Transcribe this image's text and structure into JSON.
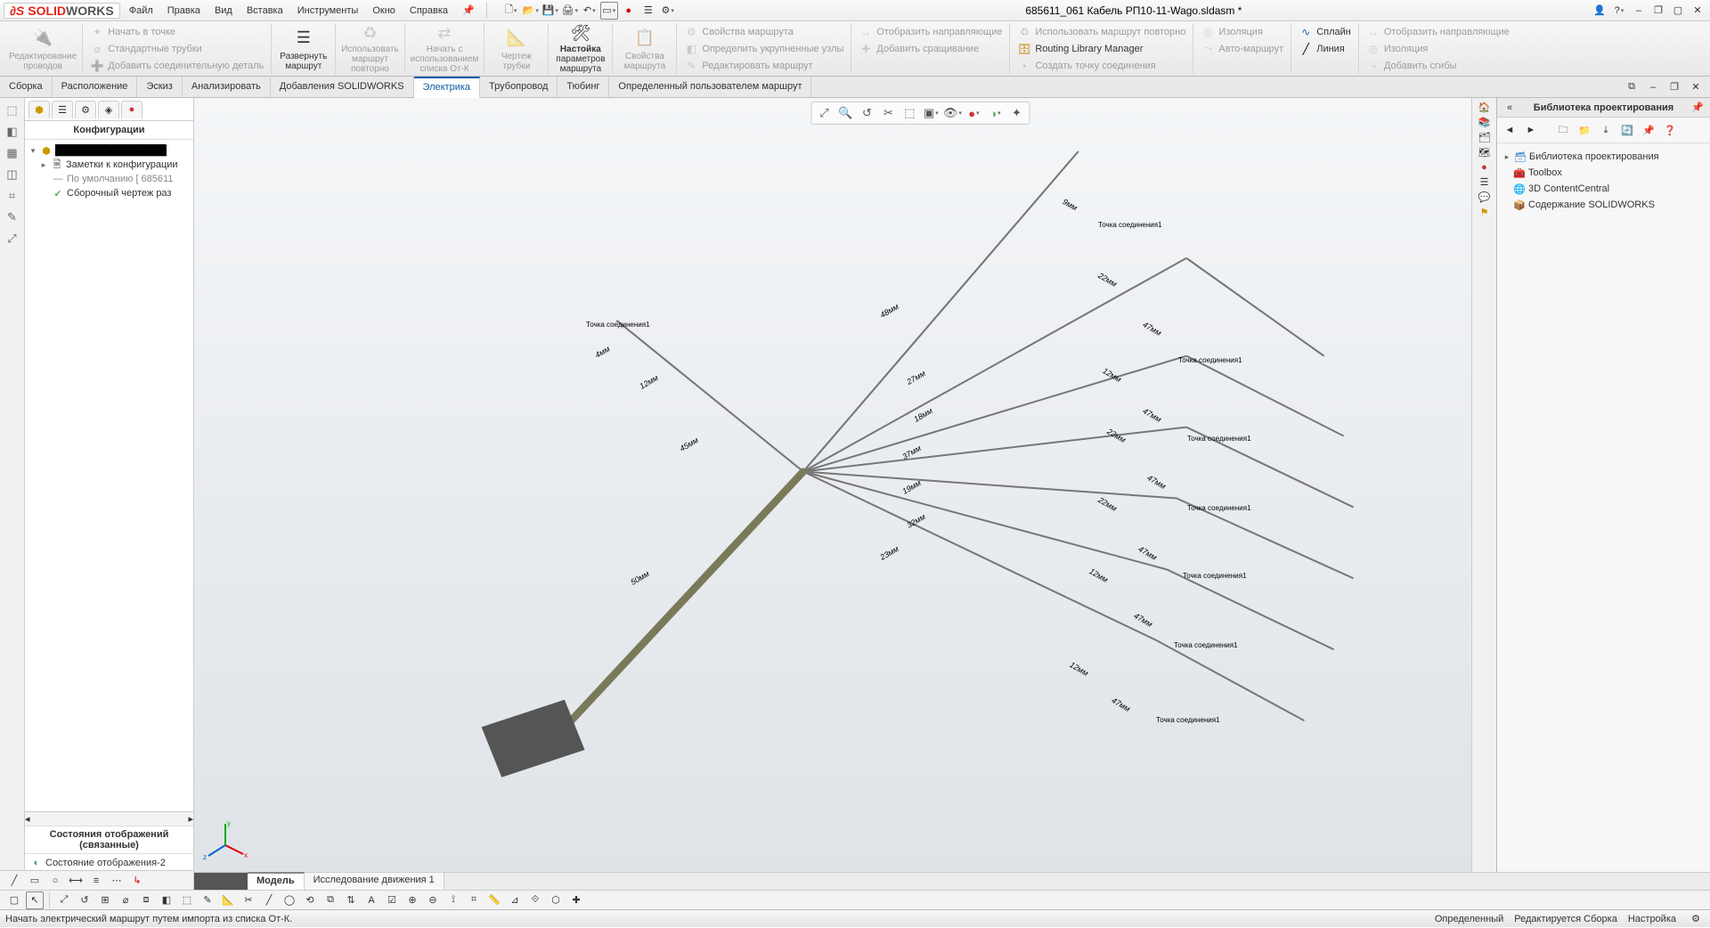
{
  "app": {
    "brand1": "SOLID",
    "brand2": "WORKS",
    "title": "685611_061 Кабель РП10-11-Wago.sldasm *"
  },
  "menu": {
    "file": "Файл",
    "edit": "Правка",
    "view": "Вид",
    "insert": "Вставка",
    "tools": "Инструменты",
    "window": "Окно",
    "help": "Справка"
  },
  "ribbon": {
    "g0": {
      "l1": "Редактирование",
      "l2": "проводов"
    },
    "g0rows": {
      "r1": "Начать в точке",
      "r2": "Стандартные трубки",
      "r3": "Добавить соединительную деталь"
    },
    "g1": {
      "l1": "Развернуть",
      "l2": "маршрут"
    },
    "g2": {
      "l1": "Использовать",
      "l2": "маршрут",
      "l3": "повторно"
    },
    "g3": {
      "l1": "Начать с",
      "l2": "использованием",
      "l3": "списка От-К"
    },
    "g4": {
      "l1": "Чертеж",
      "l2": "трубки"
    },
    "g5": {
      "l1": "Настойка",
      "l2": "параметров",
      "l3": "маршрута"
    },
    "g6": {
      "l1": "Свойства",
      "l2": "маршрута"
    },
    "col1": {
      "r1": "Свойства маршрута",
      "r2": "Определить укрупненные узлы",
      "r3": "Редактировать маршрут"
    },
    "col2": {
      "r1": "Отобразить направляющие",
      "r2": "Добавить сращивание"
    },
    "col3": {
      "r1": "Использовать маршрут повторно",
      "r2": "Routing Library Manager",
      "r3": "Создать точку соединения"
    },
    "col4": {
      "r1": "Изоляция",
      "r2": "Авто-маршрут"
    },
    "col5": {
      "r1": "Сплайн",
      "r2": "Линия"
    },
    "col6": {
      "r1": "Отобразить направляющие",
      "r2": "Изоляция",
      "r3": "Добавить сгибы"
    }
  },
  "tabs": {
    "t1": "Сборка",
    "t2": "Расположение",
    "t3": "Эскиз",
    "t4": "Анализировать",
    "t5": "Добавления SOLIDWORKS",
    "t6": "Электрика",
    "t7": "Трубопровод",
    "t8": "Тюбинг",
    "t9": "Определенный пользователем маршрут"
  },
  "fm": {
    "title": "Конфигурации",
    "root": "████████████████",
    "n1": "Заметки к конфигурации",
    "n2": "По умолчанию [ 685611",
    "n3": "Сборочный чертеж раз",
    "dispHdr": "Состояния отображений (связанные)",
    "disp1": "Состояние отображения-2"
  },
  "rp": {
    "title": "Библиотека проектирования",
    "i1": "Библиотека проектирования",
    "i2": "Toolbox",
    "i3": "3D ContentCentral",
    "i4": "Содержание SOLIDWORKS"
  },
  "btabs": {
    "model": "Модель",
    "motion": "Исследование движения 1"
  },
  "status": {
    "hint": "Начать электрический маршрут путем импорта из списка От-К.",
    "s1": "Определенный",
    "s2": "Редактируется Сборка",
    "s3": "Настройка"
  },
  "annos": {
    "cp": "Точка соединения1",
    "d50": "50мм",
    "d45": "45мм",
    "d12": "12мм",
    "d4": "4мм",
    "d48": "48мм",
    "d27": "27мм",
    "d18": "18мм",
    "d37": "37мм",
    "d19": "19мм",
    "d32": "32мм",
    "d23": "23мм",
    "d9": "9мм",
    "d22": "22мм",
    "d47": "47мм"
  }
}
